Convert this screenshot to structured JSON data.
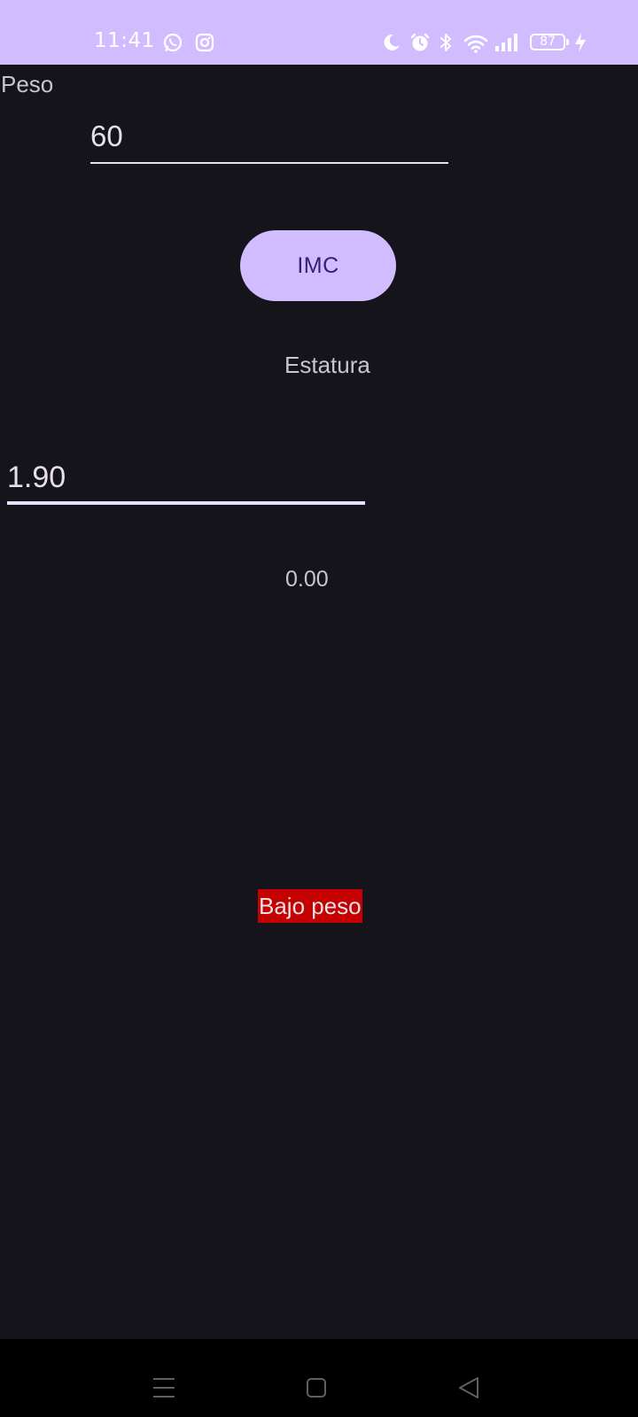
{
  "status_bar": {
    "time": "11:41",
    "battery_level": "87",
    "background_color": "#d0bcff",
    "icons": [
      "whatsapp-icon",
      "instagram-icon",
      "moon-icon",
      "alarm-icon",
      "bluetooth-icon",
      "wifi-icon",
      "signal-icon",
      "battery-icon",
      "charging-icon"
    ]
  },
  "form": {
    "peso_label": "Peso",
    "peso_value": "60",
    "imc_button_label": "IMC",
    "estatura_label": "Estatura",
    "estatura_value": "1.90"
  },
  "result": {
    "imc_value": "0.00",
    "classification": "Bajo peso",
    "classification_color": "#c40000"
  },
  "navigation": {
    "icons": [
      "menu-icon",
      "home-icon",
      "back-icon"
    ]
  },
  "colors": {
    "accent": "#d0bcff",
    "background": "#16141b",
    "text": "#cac4d0"
  }
}
